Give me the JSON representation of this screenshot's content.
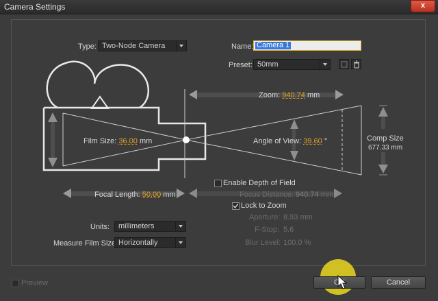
{
  "window": {
    "title": "Camera Settings",
    "close_label": "x"
  },
  "type": {
    "label": "Type:",
    "value": "Two-Node Camera"
  },
  "name": {
    "label": "Name:",
    "value": "Camera 1"
  },
  "preset": {
    "label": "Preset:",
    "value": "50mm"
  },
  "zoom": {
    "label": "Zoom:",
    "value": "940.74",
    "unit": "mm"
  },
  "film_size": {
    "label": "Film Size:",
    "value": "36.00",
    "unit": "mm"
  },
  "angle_of_view": {
    "label": "Angle of View:",
    "value": "39.60",
    "unit": "°"
  },
  "comp_size": {
    "label": "Comp Size",
    "value": "677.33 mm"
  },
  "focal_length": {
    "label": "Focal Length:",
    "value": "50.00",
    "unit": "mm"
  },
  "depth_of_field": {
    "label": "Enable Depth of Field",
    "checked": false
  },
  "focus_distance": {
    "label": "Focus Distance:",
    "value": "940.74",
    "unit": "mm"
  },
  "lock_to_zoom": {
    "label": "Lock to Zoom",
    "checked": true
  },
  "aperture": {
    "label": "Aperture:",
    "value": "8.93",
    "unit": "mm"
  },
  "f_stop": {
    "label": "F-Stop:",
    "value": "5.6"
  },
  "blur_level": {
    "label": "Blur Level:",
    "value": "100.0",
    "unit": "%"
  },
  "units": {
    "label": "Units:",
    "value": "millimeters"
  },
  "measure_film_size": {
    "label": "Measure Film Size:",
    "value": "Horizontally"
  },
  "preview": {
    "label": "Preview",
    "checked": false
  },
  "buttons": {
    "ok": "OK",
    "cancel": "Cancel"
  },
  "colors": {
    "accent": "#e3a326",
    "panel_bg": "#3c3c3c",
    "selection": "#3a78d8",
    "highlight": "#ebd71e"
  }
}
